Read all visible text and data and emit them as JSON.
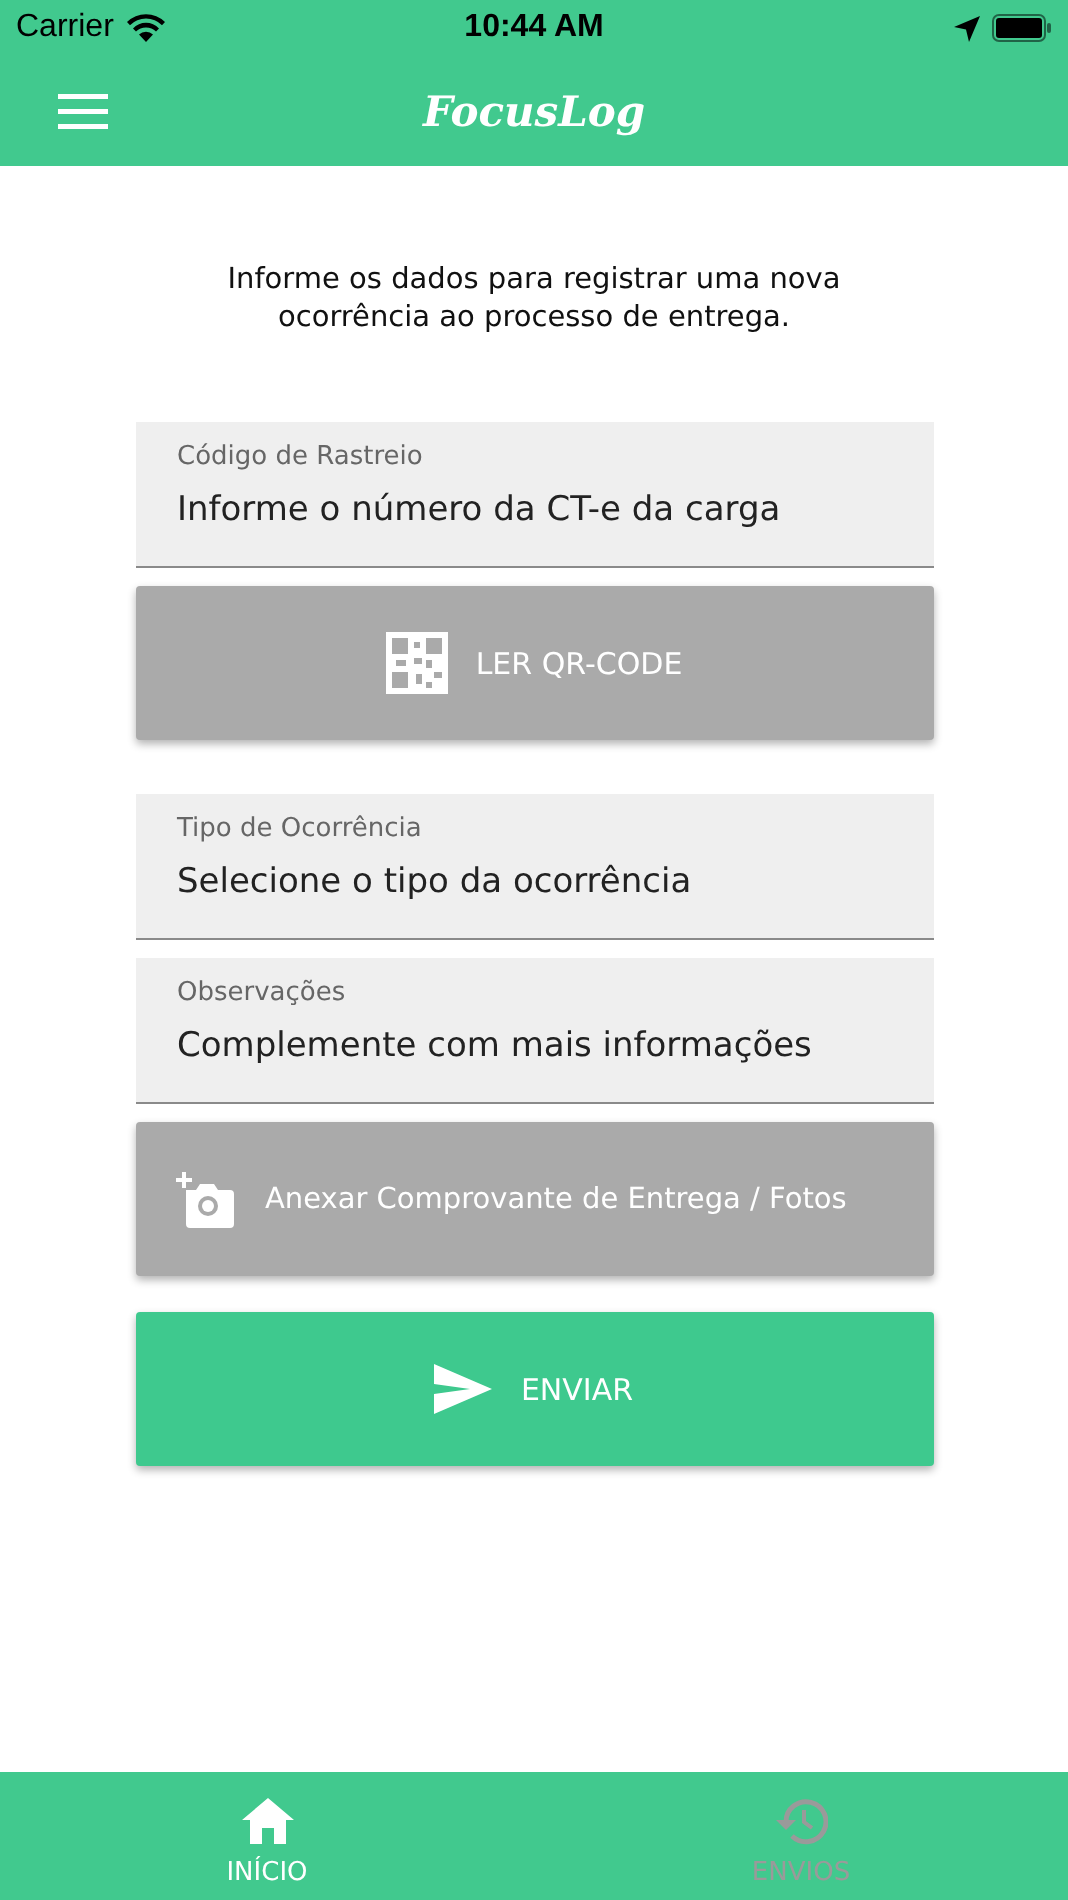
{
  "status_bar": {
    "carrier": "Carrier",
    "time": "10:44 AM"
  },
  "header": {
    "logo": "FocusLog"
  },
  "intro": "Informe os dados para registrar uma nova ocorrência ao processo de entrega.",
  "form": [
    {
      "kind": "field",
      "label": "Código de Rastreio",
      "placeholder": "Informe o número da CT-e da carga"
    },
    {
      "kind": "qr",
      "label": "LER QR-CODE"
    },
    {
      "kind": "field",
      "label": "Tipo de Ocorrência",
      "placeholder": "Selecione o tipo da ocorrência"
    },
    {
      "kind": "field",
      "label": "Observações",
      "placeholder": "Complemente com mais informações"
    },
    {
      "kind": "attach",
      "label": "Anexar Comprovante de Entrega / Fotos"
    },
    {
      "kind": "send",
      "label": "ENVIAR"
    }
  ],
  "tabs": [
    {
      "label": "INÍCIO",
      "kind": "home",
      "selected": true
    },
    {
      "label": "ENVIOS",
      "kind": "history",
      "selected": false
    }
  ]
}
